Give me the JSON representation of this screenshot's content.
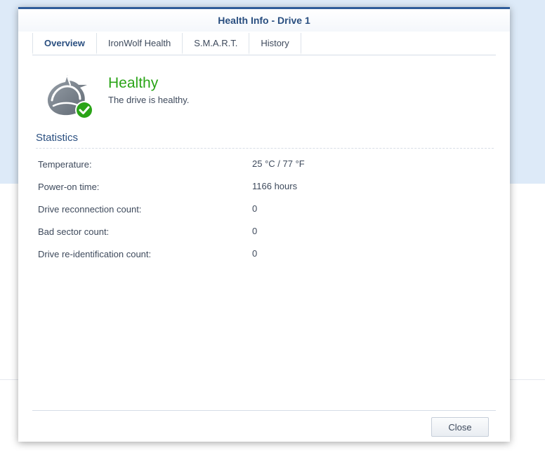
{
  "dialog": {
    "title": "Health Info - Drive 1"
  },
  "tabs": [
    {
      "label": "Overview",
      "active": true
    },
    {
      "label": "IronWolf Health",
      "active": false
    },
    {
      "label": "S.M.A.R.T.",
      "active": false
    },
    {
      "label": "History",
      "active": false
    }
  ],
  "status": {
    "icon": "drive-health-icon",
    "badge_icon": "check-icon",
    "title": "Healthy",
    "description": "The drive is healthy.",
    "color": "#2aa417"
  },
  "statistics": {
    "title": "Statistics",
    "rows": [
      {
        "label": "Temperature:",
        "value": "25 °C / 77 °F"
      },
      {
        "label": "Power-on time:",
        "value": "1166 hours"
      },
      {
        "label": "Drive reconnection count:",
        "value": "0"
      },
      {
        "label": "Bad sector count:",
        "value": "0"
      },
      {
        "label": "Drive re-identification count:",
        "value": "0"
      }
    ]
  },
  "footer": {
    "close_label": "Close"
  },
  "colors": {
    "accent": "#2a4f80",
    "title_bar_border": "#2e5c9a",
    "background_band": "#ddeaf8"
  }
}
